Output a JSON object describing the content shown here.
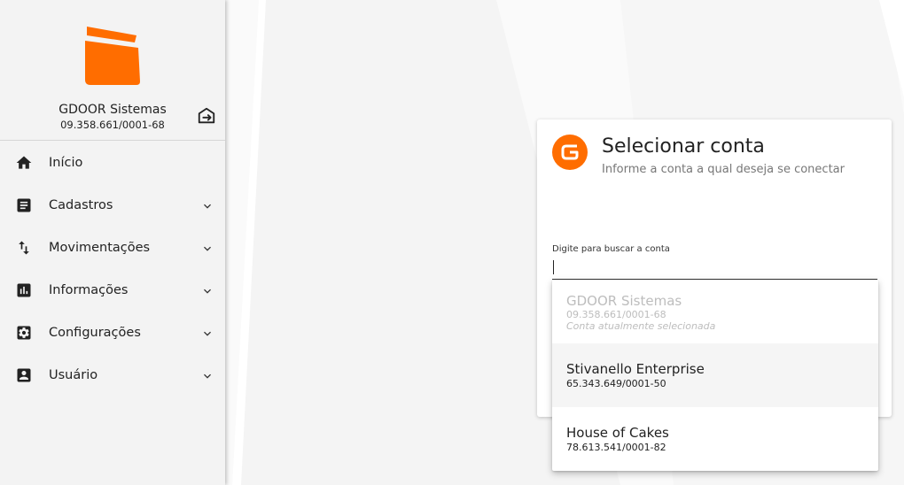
{
  "colors": {
    "brand_orange": "#ff6d00",
    "sidebar_bg": "#f3f3f3",
    "text_primary": "#222222",
    "text_disabled": "#bdbdbd"
  },
  "sidebar": {
    "company_name": "GDOOR Sistemas",
    "company_cnpj": "09.358.661/0001-68",
    "logout_icon": "logout-icon",
    "items": [
      {
        "label": "Início",
        "icon": "home-icon",
        "expandable": false
      },
      {
        "label": "Cadastros",
        "icon": "article-icon",
        "expandable": true
      },
      {
        "label": "Movimentações",
        "icon": "swap-vertical-icon",
        "expandable": true
      },
      {
        "label": "Informações",
        "icon": "bar-chart-icon",
        "expandable": true
      },
      {
        "label": "Configurações",
        "icon": "settings-icon",
        "expandable": true
      },
      {
        "label": "Usuário",
        "icon": "account-box-icon",
        "expandable": true
      }
    ]
  },
  "dialog": {
    "title": "Selecionar conta",
    "subtitle": "Informe a conta a qual deseja se conectar",
    "search_label": "Digite para buscar a conta",
    "search_value": "",
    "options": [
      {
        "name": "GDOOR Sistemas",
        "document": "09.358.661/0001-68",
        "note": "Conta atualmente selecionada",
        "disabled": true
      },
      {
        "name": "Stivanello Enterprise",
        "document": "65.343.649/0001-50",
        "note": "",
        "disabled": false
      },
      {
        "name": "House of Cakes",
        "document": "78.613.541/0001-82",
        "note": "",
        "disabled": false
      }
    ]
  }
}
